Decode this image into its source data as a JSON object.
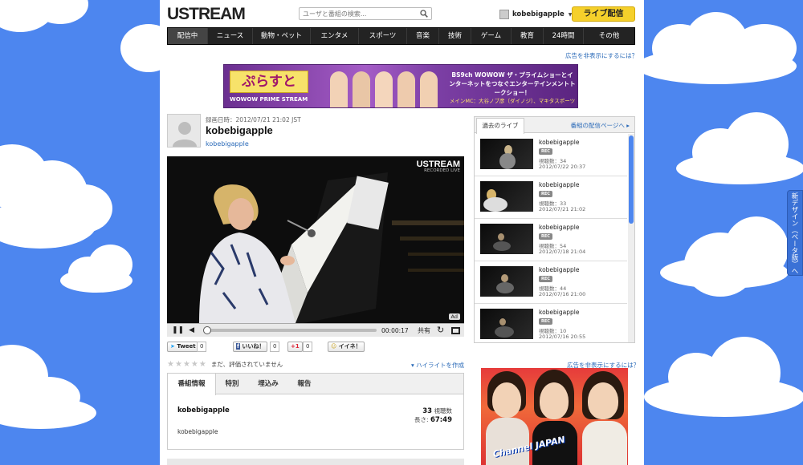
{
  "header": {
    "logo": "USTREAM",
    "search_placeholder": "ユーザと番組の検索...",
    "user_name": "kobebigapple",
    "live_button": "ライブ配信"
  },
  "nav": {
    "items": [
      "配信中",
      "ニュース",
      "動物・ペット",
      "エンタメ",
      "スポーツ",
      "音楽",
      "技術",
      "ゲーム",
      "教育",
      "24時間",
      "その他"
    ]
  },
  "ads": {
    "hide_link": "広告を非表示にするには？",
    "banner_logo": "ぷらすと",
    "banner_sub": "WOWOW PRIME STREAM",
    "banner_text": "BS9ch WOWOW ザ・プライムショーとインターネットをつなぐエンターテインメントトークショー！",
    "banner_cast": "メインMC：大谷ノブ彦（ダイノジ）、マキタスポーツ",
    "side_ad_text": "Channel JAPAN"
  },
  "video": {
    "recorded_at": "録画日時：2012/07/21 21:02 JST",
    "title": "kobebigapple",
    "channel": "kobebigapple",
    "player_logo": "USTREAM",
    "player_sub": "RECORDED LIVE",
    "ad_badge": "Ad",
    "time": "00:00:17",
    "share": "共有",
    "progress": 0.01
  },
  "social": {
    "tweet": "Tweet",
    "tweet_count": "0",
    "like": "いいね！",
    "like_count": "0",
    "gplus": "+1",
    "gplus_count": "0",
    "iine": "イイネ！"
  },
  "rating": {
    "stars": 0,
    "text": "まだ、評価されていません",
    "highlight": "ハイライトを作成"
  },
  "info_tabs": {
    "tabs": [
      "番組情報",
      "特別",
      "埋込み",
      "報告"
    ],
    "channel": "kobebigapple",
    "views_value": "33",
    "views_label": "視聴数",
    "length_label": "長さ:",
    "length_value": "67:49",
    "description": "kobebigapple"
  },
  "past_live": {
    "tab": "過去のライブ",
    "link": "番組の配信ページへ",
    "items": [
      {
        "title": "kobebigapple",
        "badge": "REC",
        "views": "視聴数：34",
        "date": "2012/07/22 20:37"
      },
      {
        "title": "kobebigapple",
        "badge": "REC",
        "views": "視聴数：33",
        "date": "2012/07/21 21:02"
      },
      {
        "title": "kobebigapple",
        "badge": "REC",
        "views": "視聴数：54",
        "date": "2012/07/18 21:04"
      },
      {
        "title": "kobebigapple",
        "badge": "REC",
        "views": "視聴数：44",
        "date": "2012/07/16 21:00"
      },
      {
        "title": "kobebigapple",
        "badge": "REC",
        "views": "視聴数：10",
        "date": "2012/07/16 20:55"
      }
    ]
  },
  "side_tab": "新デザイン（ベータ版）へ",
  "colors": {
    "background": "#4d86ef",
    "live_button": "#f5d02b",
    "nav": "#232323",
    "link": "#2a6ab8"
  }
}
